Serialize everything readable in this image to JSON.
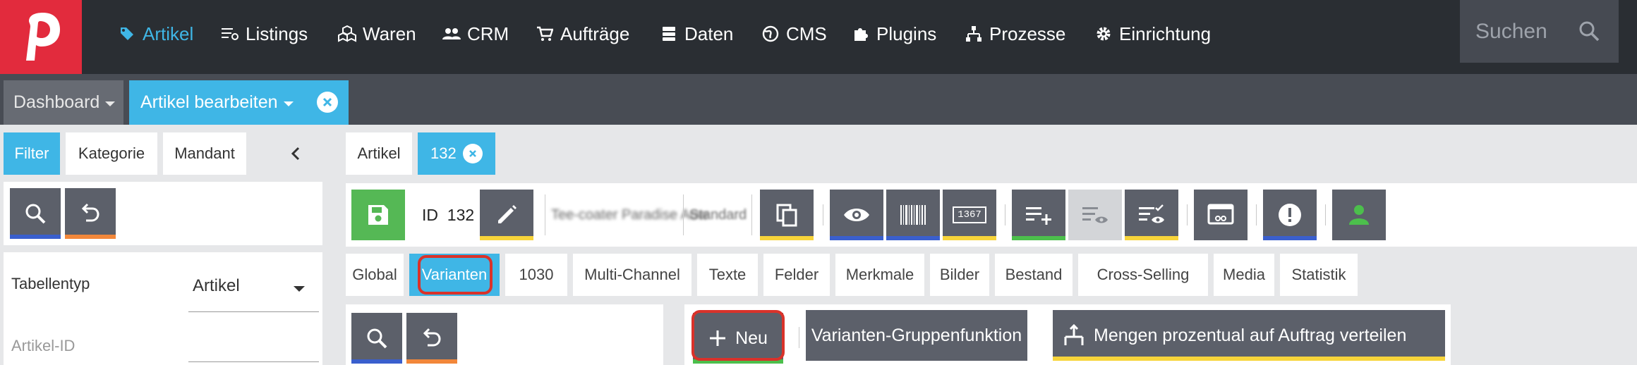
{
  "nav": {
    "items": [
      {
        "label": "Artikel",
        "icon": "tag-icon"
      },
      {
        "label": "Listings",
        "icon": "listings-icon"
      },
      {
        "label": "Waren",
        "icon": "boxes-icon"
      },
      {
        "label": "CRM",
        "icon": "users-icon"
      },
      {
        "label": "Aufträge",
        "icon": "cart-icon"
      },
      {
        "label": "Daten",
        "icon": "database-icon"
      },
      {
        "label": "CMS",
        "icon": "globe-icon"
      },
      {
        "label": "Plugins",
        "icon": "puzzle-icon"
      },
      {
        "label": "Prozesse",
        "icon": "flow-icon"
      },
      {
        "label": "Einrichtung",
        "icon": "gear-icon"
      }
    ],
    "search_placeholder": "Suchen"
  },
  "tabs": {
    "dashboard": "Dashboard",
    "edit": "Artikel bearbeiten"
  },
  "left": {
    "tabs": [
      "Filter",
      "Kategorie",
      "Mandant"
    ],
    "table_type_label": "Tabellentyp",
    "table_type_value": "Artikel",
    "id_placeholder": "Artikel-ID"
  },
  "right": {
    "tab_artikel": "Artikel",
    "tab_id": "132",
    "id_prefix": "ID",
    "id_value": "132",
    "name_value": "Tee-coater Paradise Aow",
    "variant_value": "Standard",
    "barcode_number": "1367",
    "subtabs": [
      "Global",
      "Varianten",
      "1030",
      "Multi-Channel",
      "Texte",
      "Felder",
      "Merkmale",
      "Bilder",
      "Bestand",
      "Cross-Selling",
      "Media",
      "Statistik"
    ],
    "new_button": "Neu",
    "group_button": "Varianten-Gruppenfunktion",
    "distribute_button": "Mengen prozentual auf Auftrag verteilen"
  },
  "colors": {
    "accent": "#3fb6e6",
    "brand": "#e22b3d",
    "highlight": "#d9322a"
  }
}
